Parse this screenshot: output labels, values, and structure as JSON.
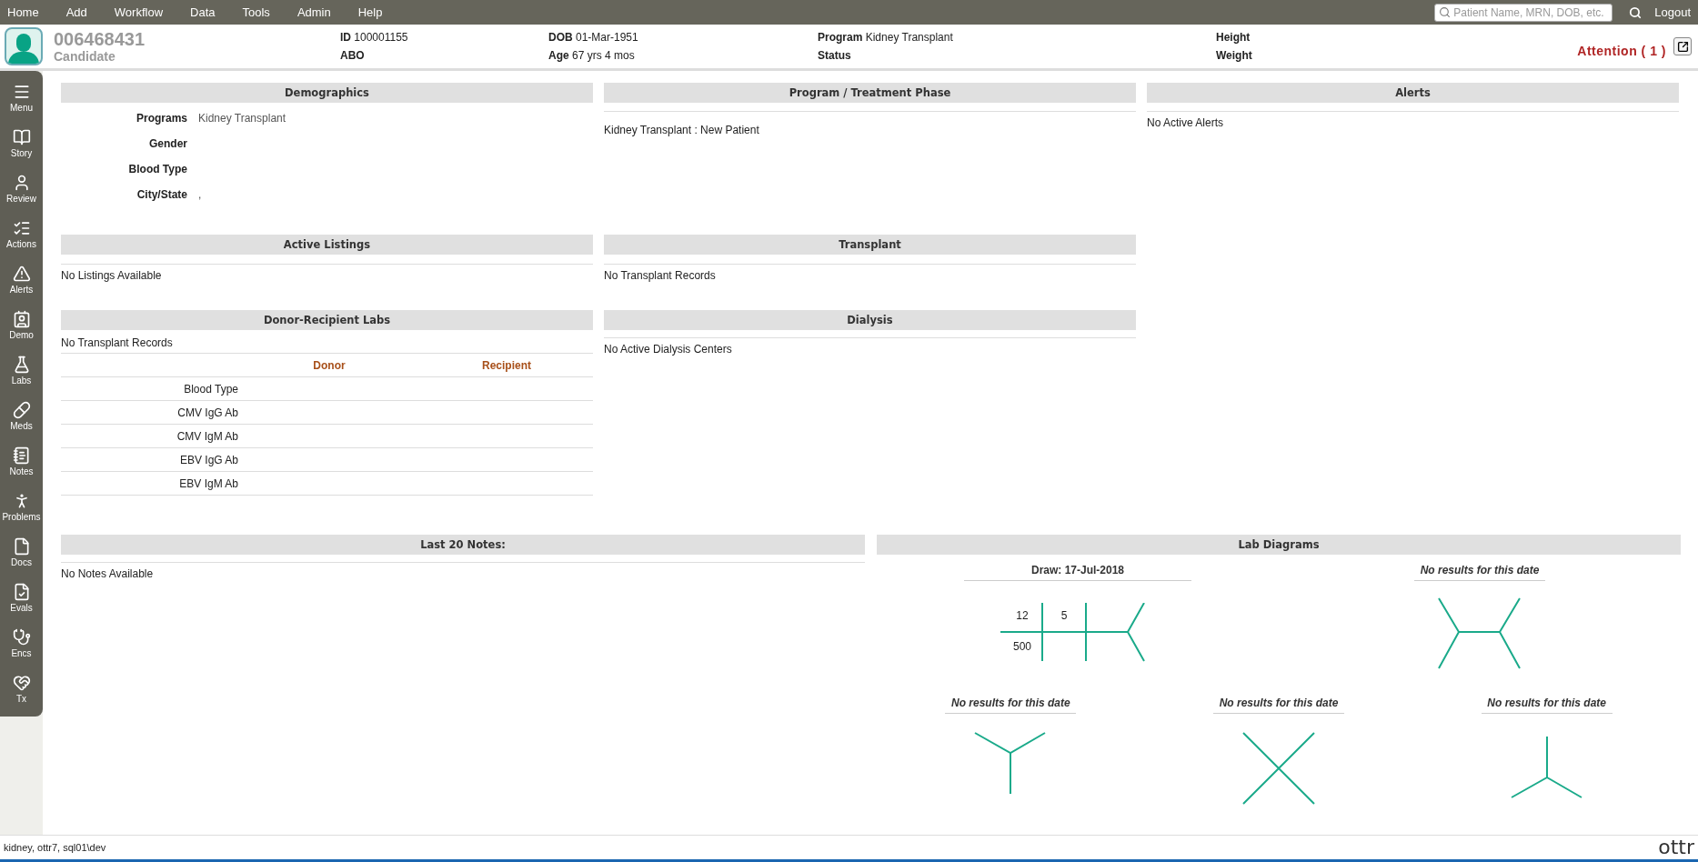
{
  "menu_bar": {
    "items": [
      "Home",
      "Add",
      "Workflow",
      "Data",
      "Tools",
      "Admin",
      "Help"
    ],
    "search": {
      "placeholder": "Patient Name, MRN, DOB, etc."
    },
    "logout": "Logout"
  },
  "patient_header": {
    "mrn": "006468431",
    "status_label": "Candidate",
    "fields": [
      {
        "label": "ID",
        "value": "100001155"
      },
      {
        "label": "ABO"
      },
      {
        "label": "DOB",
        "value": "01-Mar-1951"
      },
      {
        "label": "Age",
        "value": "67 yrs 4 mos"
      },
      {
        "label": "Program",
        "value": "Kidney Transplant"
      },
      {
        "label": "Status"
      },
      {
        "label": "Height"
      },
      {
        "label": "Weight"
      }
    ],
    "attention": "Attention ( 1 )"
  },
  "sidebar": {
    "items": [
      {
        "kind": "menu",
        "label": "Menu"
      },
      {
        "kind": "story",
        "label": "Story"
      },
      {
        "kind": "review",
        "label": "Review"
      },
      {
        "kind": "actions",
        "label": "Actions"
      },
      {
        "kind": "alerts",
        "label": "Alerts"
      },
      {
        "kind": "demo",
        "label": "Demo"
      },
      {
        "kind": "labs",
        "label": "Labs"
      },
      {
        "kind": "meds",
        "label": "Meds"
      },
      {
        "kind": "notes",
        "label": "Notes"
      },
      {
        "kind": "problems",
        "label": "Problems"
      },
      {
        "kind": "docs",
        "label": "Docs"
      },
      {
        "kind": "evals",
        "label": "Evals"
      },
      {
        "kind": "encs",
        "label": "Encs"
      },
      {
        "kind": "tx",
        "label": "Tx"
      }
    ]
  },
  "demographics": {
    "title": "Demographics",
    "rows": [
      {
        "label": "Programs",
        "value": "Kidney Transplant"
      },
      {
        "label": "Gender"
      },
      {
        "label": "Blood Type"
      },
      {
        "label": "City/State",
        "value": ","
      }
    ]
  },
  "program_phase": {
    "title": "Program / Treatment Phase",
    "text": "Kidney Transplant : New Patient"
  },
  "alerts": {
    "title": "Alerts",
    "text": "No Active Alerts"
  },
  "active_listings": {
    "title": "Active Listings",
    "text": "No Listings Available"
  },
  "transplant": {
    "title": "Transplant",
    "text": "No Transplant Records"
  },
  "donor_recipient_labs": {
    "title": "Donor-Recipient Labs",
    "text": "No Transplant Records",
    "columns": [
      "Donor",
      "Recipient"
    ],
    "rows": [
      "Blood Type",
      "CMV IgG Ab",
      "CMV IgM Ab",
      "EBV IgG Ab",
      "EBV IgM Ab"
    ]
  },
  "dialysis": {
    "title": "Dialysis",
    "text": "No Active Dialysis Centers"
  },
  "notes": {
    "title": "Last 20 Notes:",
    "text": "No Notes Available"
  },
  "lab_diagrams": {
    "title": "Lab Diagrams",
    "rows": [
      [
        {
          "kind": "fishbone",
          "title": "Draw: 17-Jul-2018",
          "values": [
            "12",
            "5",
            "500"
          ]
        },
        {
          "kind": "h",
          "title": "No results for this date"
        }
      ],
      [
        {
          "kind": "y",
          "title": "No results for this date"
        },
        {
          "kind": "x",
          "title": "No results for this date"
        },
        {
          "kind": "inverted_y",
          "title": "No results for this date"
        }
      ]
    ]
  },
  "status_bar": {
    "text": "kidney, ottr7, sql01\\dev",
    "logo": "ottr"
  }
}
